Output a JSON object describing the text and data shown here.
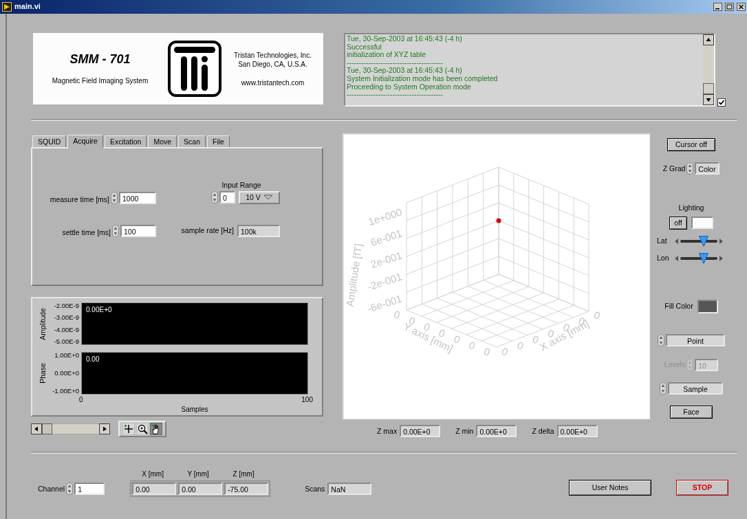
{
  "window": {
    "title": "main.vi"
  },
  "header": {
    "product": "SMM - 701",
    "subtitle": "Magnetic Field Imaging System",
    "company_lines": [
      "Tristan Technologies, Inc.",
      "San Diego, CA, U.S.A."
    ],
    "website": "www.tristantech.com"
  },
  "log": {
    "lines": [
      "Tue, 30-Sep-2003 at 16:45:43 (-4 h)",
      "Successful",
      "initialization of XYZ table",
      "----------------------------------------",
      "Tue, 30-Sep-2003 at 16:45:43 (-4 h)",
      "System Initialization mode has been completed",
      "Proceeding to System Operation mode",
      "----------------------------------------"
    ],
    "checkbox": {
      "checked": true
    }
  },
  "tabs": [
    {
      "label": "SQUID",
      "selected": false
    },
    {
      "label": "Acquire",
      "selected": true
    },
    {
      "label": "Excitation",
      "selected": false
    },
    {
      "label": "Move",
      "selected": false
    },
    {
      "label": "Scan",
      "selected": false
    },
    {
      "label": "File",
      "selected": false
    }
  ],
  "acquire": {
    "measure_time": {
      "label": "measure time [ms]",
      "value": "1000"
    },
    "settle_time": {
      "label": "settle time [ms]",
      "value": "100"
    },
    "input_range": {
      "label": "Input Range",
      "index": "0",
      "value": "10 V"
    },
    "sample_rate": {
      "label": "sample rate [Hz]",
      "value": "100k"
    }
  },
  "waveform": {
    "amplitude": {
      "axis_label": "Amplitude",
      "ticks": [
        "-2.00E-9",
        "-3.00E-9",
        "-4.00E-9",
        "-5.00E-9"
      ],
      "readout": "0.00E+0"
    },
    "phase": {
      "axis_label": "Phase",
      "ticks": [
        "1.00E+0",
        "0.00E+0",
        "-1.00E+0"
      ],
      "readout": "0.00"
    },
    "x_ticks": [
      "0",
      "100"
    ],
    "xlabel": "Samples",
    "tools": [
      {
        "kind": "crosshair",
        "selected": false
      },
      {
        "kind": "zoom",
        "selected": false
      },
      {
        "kind": "pan",
        "selected": true
      }
    ]
  },
  "graph3d": {
    "z_label": "Amplitude [fT]",
    "z_ticks": [
      "1e+000",
      "6e-001",
      "2e-001",
      "-2e-001",
      "-6e-001"
    ],
    "y_label": "Y axis [mm]",
    "y_ticks": [
      "0",
      "0",
      "0",
      "0",
      "0",
      "0",
      "0"
    ],
    "x_label": "X axis [mm]",
    "x_ticks": [
      "0",
      "0",
      "0",
      "0",
      "0",
      "0",
      "0"
    ]
  },
  "z_stats": [
    {
      "label": "Z max",
      "value": "0.00E+0"
    },
    {
      "label": "Z min",
      "value": "0.00E+0"
    },
    {
      "label": "Z delta",
      "value": "0.00E+0"
    }
  ],
  "controls": {
    "cursor_button": "Cursor off",
    "z_grad": {
      "label": "Z Grad",
      "value": "Color"
    },
    "lighting": {
      "label": "Lighting",
      "button": "off",
      "sliders": [
        {
          "label": "Lat",
          "level": 0.62
        },
        {
          "label": "Lon",
          "level": 0.63
        }
      ]
    },
    "fill_color": {
      "label": "Fill Color"
    },
    "plot_style": "Point",
    "levels": {
      "label": "Levels",
      "value": "10",
      "disabled": true
    },
    "mode": "Sample",
    "face_button": "Face"
  },
  "bottom": {
    "channel": {
      "label": "Channel",
      "value": "1"
    },
    "position": [
      {
        "label": "X [mm]",
        "value": "0.00"
      },
      {
        "label": "Y [mm]",
        "value": "0.00"
      },
      {
        "label": "Z [mm]",
        "value": "-75.00"
      }
    ],
    "scans": {
      "label": "Scans",
      "value": "NaN"
    },
    "buttons": [
      {
        "label": "User Notes",
        "kind": "normal"
      },
      {
        "label": "STOP",
        "kind": "stop"
      }
    ]
  }
}
